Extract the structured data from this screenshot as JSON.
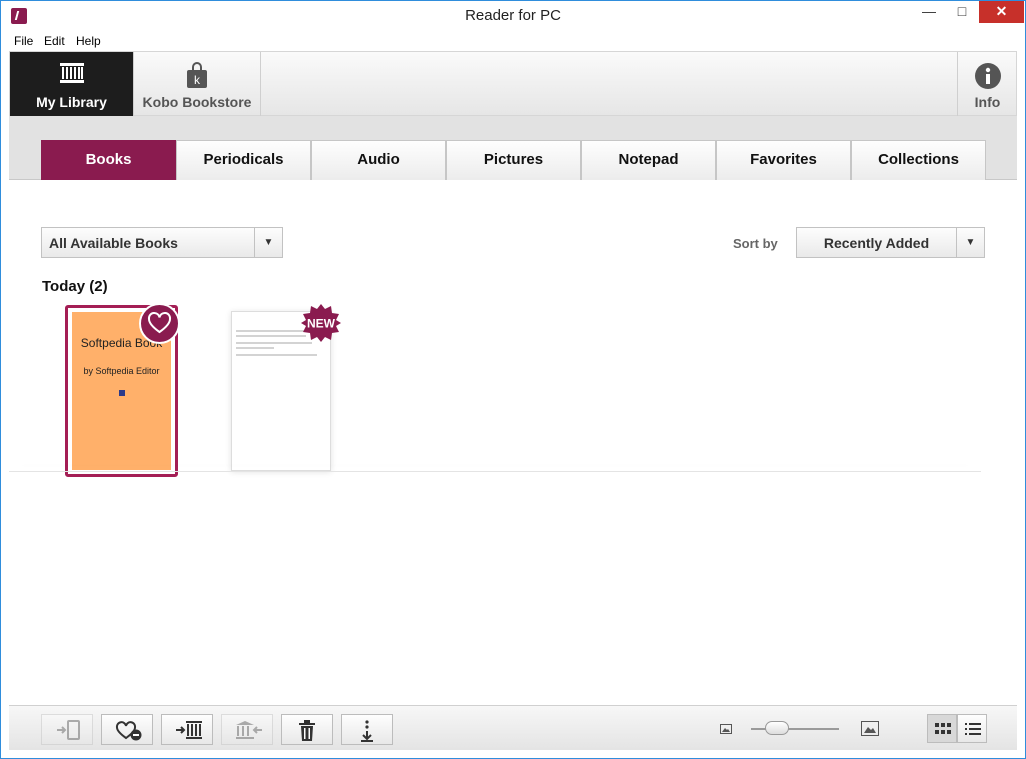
{
  "window": {
    "title": "Reader for PC"
  },
  "menu": [
    "File",
    "Edit",
    "Help"
  ],
  "nav": {
    "library": "My Library",
    "store": "Kobo Bookstore",
    "info": "Info"
  },
  "tabs": [
    "Books",
    "Periodicals",
    "Audio",
    "Pictures",
    "Notepad",
    "Favorites",
    "Collections"
  ],
  "active_tab": "Books",
  "filter": {
    "value": "All Available Books"
  },
  "sort": {
    "label": "Sort by",
    "value": "Recently Added"
  },
  "section": {
    "title": "Today (2)"
  },
  "books": [
    {
      "title": "Softpedia Book",
      "author": "by Softpedia Editor",
      "favorite": true,
      "cover_color": "#ffb06a"
    },
    {
      "badge": "NEW"
    }
  ],
  "toolbar": {
    "buttons": [
      "send-to-device-icon",
      "remove-favorite-icon",
      "add-to-collection-icon",
      "return-to-library-icon",
      "delete-icon",
      "more-options-icon"
    ]
  },
  "zoom": {
    "level": 0.3
  },
  "colors": {
    "accent": "#8a1b4f",
    "titlebar_border": "#2f8ddc",
    "close_button": "#c7302a"
  }
}
